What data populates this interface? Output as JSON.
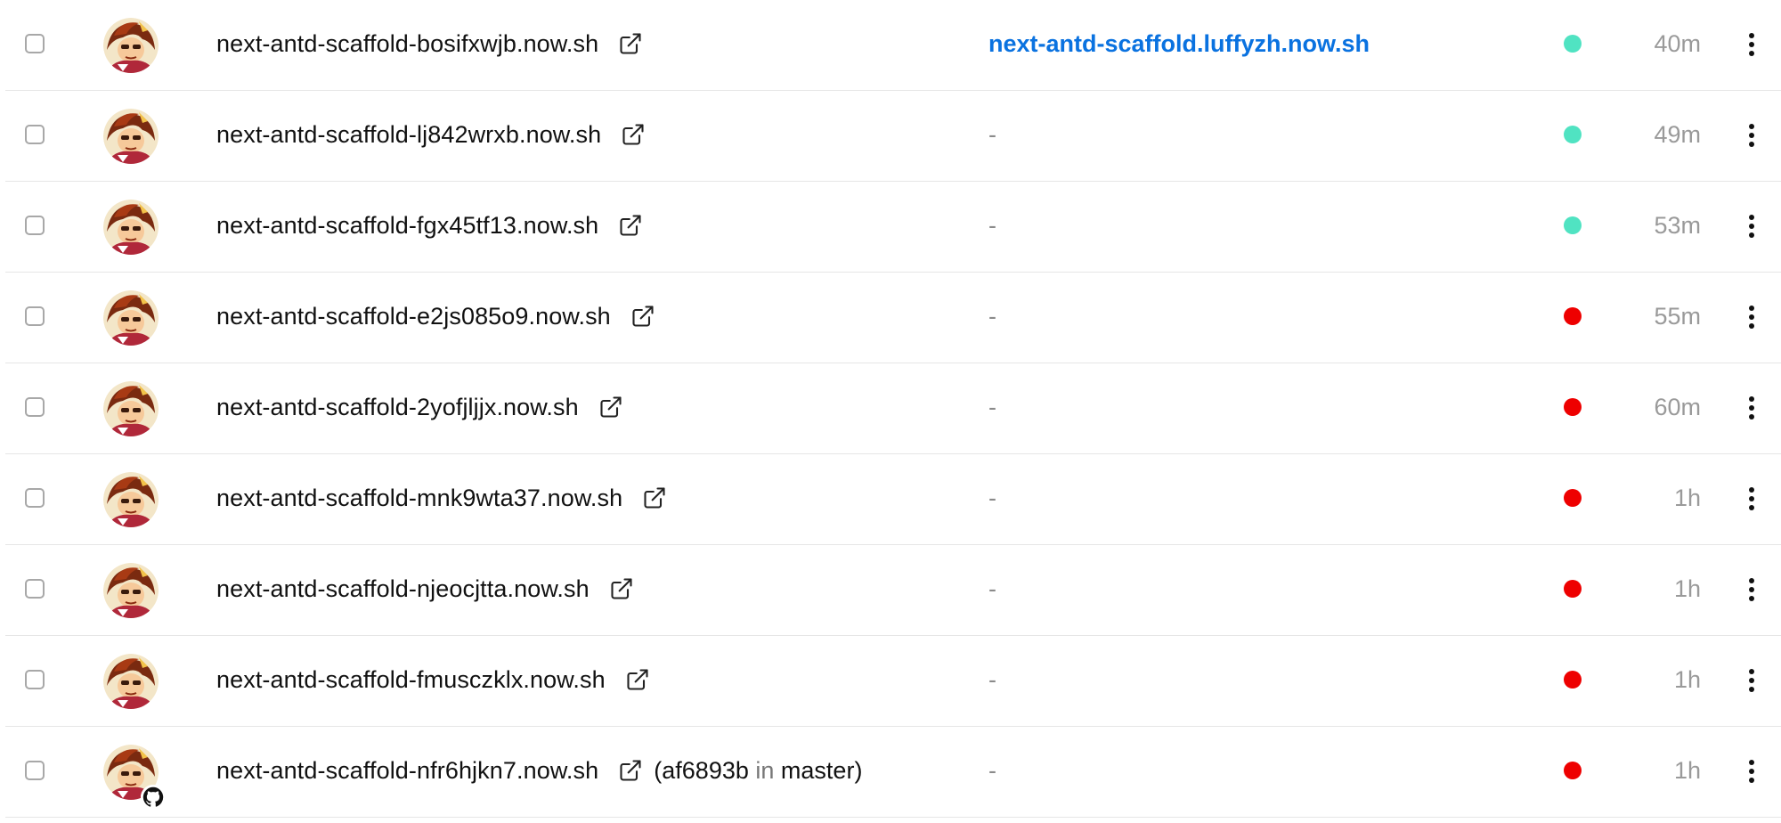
{
  "deployments": [
    {
      "url": "next-antd-scaffold-bosifxwjb.now.sh",
      "alias": "next-antd-scaffold.luffyzh.now.sh",
      "status": "ready",
      "age": "40m",
      "commit": null
    },
    {
      "url": "next-antd-scaffold-lj842wrxb.now.sh",
      "alias": "-",
      "status": "ready",
      "age": "49m",
      "commit": null
    },
    {
      "url": "next-antd-scaffold-fgx45tf13.now.sh",
      "alias": "-",
      "status": "ready",
      "age": "53m",
      "commit": null
    },
    {
      "url": "next-antd-scaffold-e2js085o9.now.sh",
      "alias": "-",
      "status": "error",
      "age": "55m",
      "commit": null
    },
    {
      "url": "next-antd-scaffold-2yofjljjx.now.sh",
      "alias": "-",
      "status": "error",
      "age": "60m",
      "commit": null
    },
    {
      "url": "next-antd-scaffold-mnk9wta37.now.sh",
      "alias": "-",
      "status": "error",
      "age": "1h",
      "commit": null
    },
    {
      "url": "next-antd-scaffold-njeocjtta.now.sh",
      "alias": "-",
      "status": "error",
      "age": "1h",
      "commit": null
    },
    {
      "url": "next-antd-scaffold-fmusczklx.now.sh",
      "alias": "-",
      "status": "error",
      "age": "1h",
      "commit": null
    },
    {
      "url": "next-antd-scaffold-nfr6hjkn7.now.sh",
      "alias": "-",
      "status": "error",
      "age": "1h",
      "commit": {
        "open": "(",
        "sha": "af6893b",
        "in": "in",
        "branch": "master",
        "close": ")"
      }
    }
  ],
  "status_colors": {
    "ready": "#50e3c2",
    "error": "#ee0000"
  },
  "icons": {
    "checkbox": "checkbox-icon",
    "avatar": "avatar-icon",
    "external_link": "external-link-icon",
    "github_badge": "github-icon",
    "menu": "more-vertical-icon"
  }
}
